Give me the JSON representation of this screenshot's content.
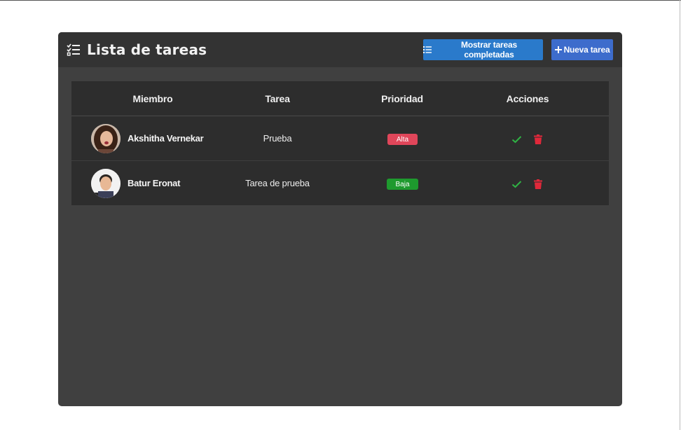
{
  "header": {
    "title": "Lista de tareas",
    "title_icon": "task-list-icon",
    "show_completed_label": "Mostrar tareas completadas",
    "show_completed_icon": "list-icon",
    "new_task_label": "Nueva tarea",
    "new_task_icon": "plus-icon"
  },
  "table": {
    "columns": [
      "Miembro",
      "Tarea",
      "Prioridad",
      "Acciones"
    ],
    "rows": [
      {
        "member": "Akshitha Vernekar",
        "task": "Prueba",
        "priority": "Alta",
        "priority_color": "#e0465a"
      },
      {
        "member": "Batur Eronat",
        "task": "Tarea de prueba",
        "priority": "Baja",
        "priority_color": "#1e9a2e"
      }
    ],
    "action_icons": [
      "check-icon",
      "trash-icon"
    ]
  },
  "colors": {
    "card_bg": "#404040",
    "header_bg": "#333333",
    "table_bg": "#2d2d2d",
    "button_completed": "#2a7acb",
    "button_new": "#3d6ccc",
    "check": "#2fb344",
    "delete": "#e0283a"
  }
}
